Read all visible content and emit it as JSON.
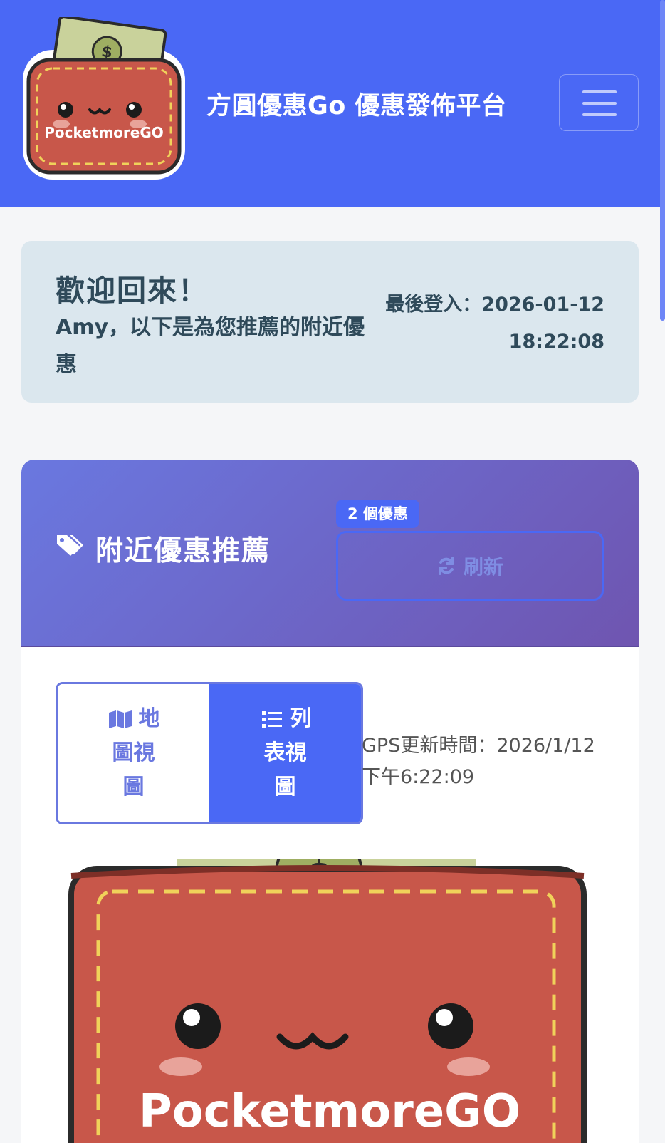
{
  "header": {
    "logo_text": "PocketmoreGO",
    "title": "方圓優惠Go 優惠發佈平台",
    "menu_icon": "hamburger-icon"
  },
  "welcome": {
    "title": "歡迎回來！",
    "subtitle": "Amy，以下是為您推薦的附近優惠",
    "last_login_label": "最後登入：2026-01-12",
    "last_login_time": "18:22:08"
  },
  "nearby": {
    "title": "附近優惠推薦",
    "title_icon": "tags-icon",
    "count_badge": "2 個優惠",
    "refresh_label": "刷新",
    "refresh_icon": "sync-icon",
    "view_toggle": {
      "map": {
        "line1": "地",
        "line2": "圖視",
        "line3": "圖",
        "icon": "map-icon",
        "active": false
      },
      "list": {
        "line1": "列",
        "line2": "表視",
        "line3": "圖",
        "icon": "list-icon",
        "active": true
      }
    },
    "gps_time": "GPS更新時間：2026/1/12 下午6:22:09",
    "coupon_image_text": "PocketmoreGO"
  },
  "colors": {
    "primary": "#4a68f5",
    "header_gradient_start": "#6a78e0",
    "header_gradient_end": "#6f55b0",
    "welcome_bg": "#dbe7ee",
    "wallet_red": "#c8574a"
  }
}
